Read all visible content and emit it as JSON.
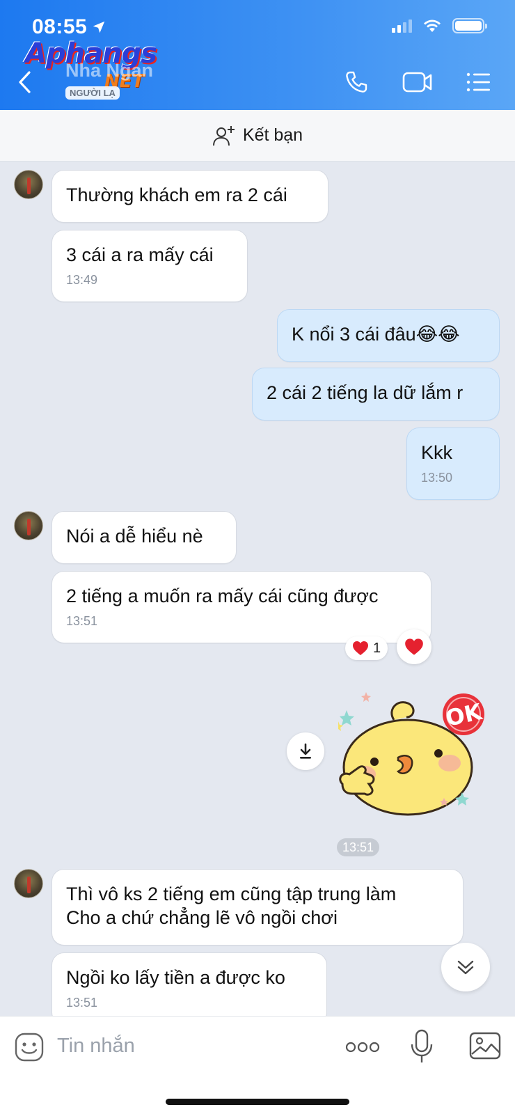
{
  "status_bar": {
    "time": "08:55"
  },
  "header": {
    "contact_name": "Nha Ngan",
    "contact_badge": "NGƯỜI LẠ",
    "watermark_main": "Aphangs",
    "watermark_sub": "NET"
  },
  "friend_bar": {
    "label": "Kết bạn"
  },
  "messages": [
    {
      "side": "in",
      "text": "Thường khách em ra 2 cái"
    },
    {
      "side": "in",
      "text": "3 cái a ra mấy cái",
      "time": "13:49"
    },
    {
      "side": "out",
      "text": "K nổi 3 cái đâu😂😂"
    },
    {
      "side": "out",
      "text": "2 cái 2 tiếng la dữ lắm r"
    },
    {
      "side": "out",
      "text": "Kkk",
      "time": "13:50"
    },
    {
      "side": "in",
      "text": "Nói a dễ hiểu nè"
    },
    {
      "side": "in",
      "text": "2 tiếng a muốn ra mấy cái cũng được",
      "time": "13:51"
    },
    {
      "side": "in",
      "text_line1": "Thì vô ks 2  tiếng em cũng tập trung làm",
      "text_line2": "Cho a chứ chẳng lẽ vô ngồi chơi"
    },
    {
      "side": "in",
      "text": "Ngồi ko lấy tiền a được ko",
      "time": "13:51"
    }
  ],
  "reaction": {
    "count": "1"
  },
  "sticker": {
    "text": "OK",
    "time": "13:51"
  },
  "input": {
    "placeholder": "Tin nhắn"
  },
  "colors": {
    "header_start": "#1d79f0",
    "header_end": "#5aa6f6",
    "outgoing_bubble": "#d8ebfd",
    "incoming_bubble": "#ffffff",
    "chat_bg": "#e4e8f0"
  },
  "icons": [
    "location-arrow-icon",
    "signal-icon",
    "wifi-icon",
    "battery-icon",
    "back-icon",
    "phone-icon",
    "video-icon",
    "menu-icon",
    "add-friend-icon",
    "heart-icon",
    "download-icon",
    "chevron-down-icon",
    "emoji-icon",
    "more-icon",
    "mic-icon",
    "gallery-icon"
  ]
}
